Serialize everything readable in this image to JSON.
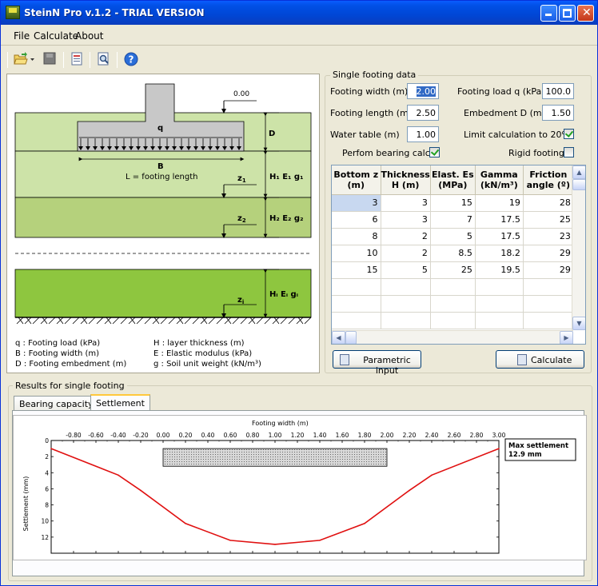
{
  "window": {
    "title": "SteinN Pro v.1.2 - TRIAL VERSION"
  },
  "menu": [
    "File",
    "Calculate",
    "About"
  ],
  "toolbar": [
    "open-icon",
    "save-icon",
    "report-icon",
    "preview-icon",
    "help-icon"
  ],
  "diagram": {
    "ground_level": "0.00",
    "q": "q",
    "D": "D",
    "B": "B",
    "L_note": "L = footing length",
    "z1": "z",
    "z1_sub": "1",
    "z2": "z",
    "z2_sub": "2",
    "zi": "z",
    "zi_sub": "i",
    "layer1": "H₁ E₁ g₁",
    "layer2": "H₂ E₂ g₂",
    "layeri": "Hᵢ Eᵢ gᵢ",
    "legend": [
      "q : Footing load (kPa)",
      "B : Footing width (m)",
      "D : Footing embedment (m)",
      "H : layer thickness (m)",
      "E : Elastic modulus (kPa)",
      "g : Soil unit weight (kN/m³)"
    ]
  },
  "footing": {
    "group_label": "Single footing data",
    "width_label": "Footing width (m)",
    "width_value": "2.00",
    "load_label": "Footing load q (kPa)",
    "load_value": "100.0",
    "length_label": "Footing length (m)",
    "length_value": "2.50",
    "embed_label": "Embedment D (m)",
    "embed_value": "1.50",
    "water_label": "Water table (m)",
    "water_value": "1.00",
    "limit_label": "Limit calculation to 20%",
    "limit_checked": true,
    "bearing_label": "Perfom bearing calc.",
    "bearing_checked": true,
    "rigid_label": "Rigid footing",
    "rigid_checked": false
  },
  "layers": {
    "headers": [
      [
        "Bottom z",
        "(m)"
      ],
      [
        "Thickness",
        "H (m)"
      ],
      [
        "Elast. Es",
        "(MPa)"
      ],
      [
        "Gamma",
        "(kN/m³)"
      ],
      [
        "Friction",
        "angle (º)"
      ]
    ],
    "rows": [
      [
        "3",
        "3",
        "15",
        "19",
        "28"
      ],
      [
        "6",
        "3",
        "7",
        "17.5",
        "25"
      ],
      [
        "8",
        "2",
        "5",
        "17.5",
        "23"
      ],
      [
        "10",
        "2",
        "8.5",
        "18.2",
        "29"
      ],
      [
        "15",
        "5",
        "25",
        "19.5",
        "29"
      ]
    ]
  },
  "buttons": {
    "parametric": "Parametric input",
    "calculate": "Calculate"
  },
  "results": {
    "group_label": "Results for single footing",
    "tabs": [
      "Bearing capacity",
      "Settlement"
    ],
    "active_tab": "Settlement"
  },
  "chart_data": {
    "type": "line",
    "title": "",
    "xlabel": "Footing width (m)",
    "ylabel": "Settlement (mm)",
    "xlim": [
      -1.0,
      3.0
    ],
    "ylim": [
      0,
      14
    ],
    "y_inverted": true,
    "x_ticks": [
      "-0.80",
      "-0.60",
      "-0.40",
      "-0.20",
      "0.00",
      "0.20",
      "0.40",
      "0.60",
      "0.80",
      "1.00",
      "1.20",
      "1.40",
      "1.60",
      "1.80",
      "2.00",
      "2.20",
      "2.40",
      "2.60",
      "2.80",
      "3.00"
    ],
    "y_ticks": [
      "0",
      "2",
      "4",
      "6",
      "8",
      "10",
      "12"
    ],
    "footing_extent": [
      0.0,
      2.0
    ],
    "footing_depth": [
      1.0,
      3.2
    ],
    "series": [
      {
        "color": "#e01010",
        "x": [
          -1.0,
          -0.4,
          -0.2,
          0.2,
          0.6,
          1.0,
          1.4,
          1.8,
          2.2,
          2.4,
          3.0
        ],
        "y": [
          1.0,
          4.3,
          6.2,
          10.3,
          12.4,
          12.9,
          12.4,
          10.3,
          6.2,
          4.3,
          1.0
        ]
      }
    ],
    "annotation": [
      "Max settlement",
      "12.9 mm"
    ]
  }
}
